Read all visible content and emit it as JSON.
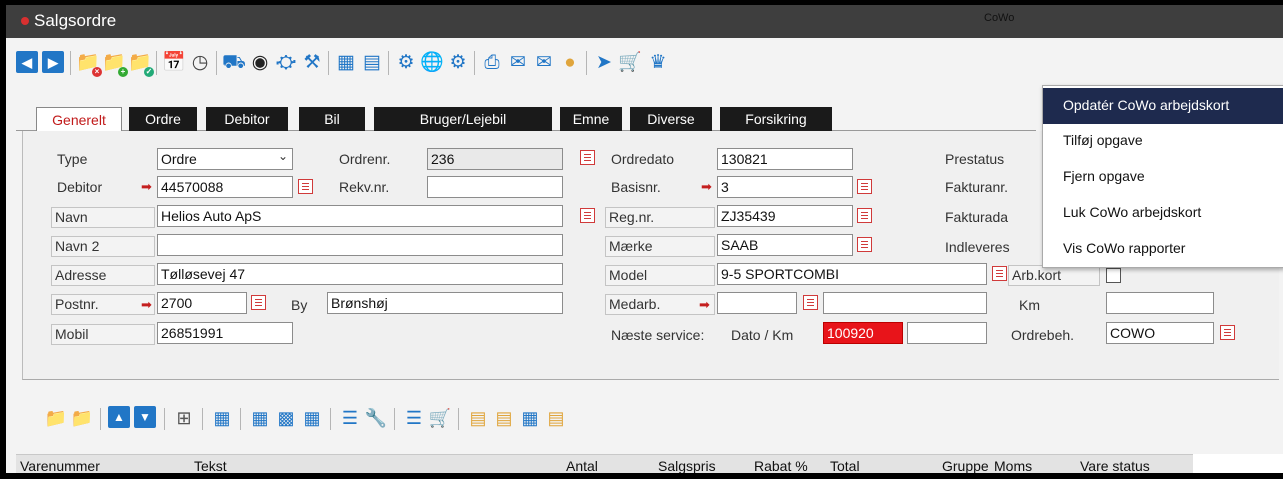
{
  "window": {
    "title": "Salgsordre"
  },
  "toolbar": {
    "icons": [
      "back-arrow",
      "forward-arrow",
      "folder-delete",
      "folder-add",
      "folder-check",
      "calendar",
      "clock",
      "truck",
      "tire",
      "car-key",
      "paint-bucket",
      "columns",
      "comment",
      "tools",
      "globe",
      "gear",
      "printer",
      "mail",
      "mail-checked",
      "coins",
      "document-send",
      "cart",
      "crown"
    ],
    "cowo_label": "CoWo"
  },
  "tabs": [
    "Generelt",
    "Ordre",
    "Debitor",
    "Bil",
    "Bruger/Lejebil",
    "Emne",
    "Diverse",
    "Forsikring"
  ],
  "form": {
    "type_label": "Type",
    "type_value": "Ordre",
    "ordrenr_label": "Ordrenr.",
    "ordrenr_value": "236",
    "ordredato_label": "Ordredato",
    "ordredato_value": "130821",
    "prestatus_label": "Prestatus",
    "debitor_label": "Debitor",
    "debitor_value": "44570088",
    "rekvnr_label": "Rekv.nr.",
    "rekvnr_value": "",
    "basisnr_label": "Basisnr.",
    "basisnr_value": "3",
    "fakturanr_label": "Fakturanr.",
    "navn_label": "Navn",
    "navn_value": "Helios Auto ApS",
    "regnr_label": "Reg.nr.",
    "regnr_value": "ZJ35439",
    "fakturadato_label": "Fakturada",
    "navn2_label": "Navn 2",
    "navn2_value": "",
    "maerke_label": "Mærke",
    "maerke_value": "SAAB",
    "indleveres_label": "Indleveres",
    "adresse_label": "Adresse",
    "adresse_value": "Tølløsevej 47",
    "model_label": "Model",
    "model_value": "9-5 SPORTCOMBI",
    "arbkort_label": "Arb.kort",
    "postnr_label": "Postnr.",
    "postnr_value": "2700",
    "by_label": "By",
    "by_value": "Brønshøj",
    "medarb_label": "Medarb.",
    "km_label": "Km",
    "mobil_label": "Mobil",
    "mobil_value": "26851991",
    "naeste_service_label": "Næste service:",
    "dato_km_label": "Dato / Km",
    "service_dato_value": "100920",
    "ordrebeh_label": "Ordrebeh.",
    "ordrebeh_value": "COWO"
  },
  "context_menu": {
    "items": [
      "Opdatér CoWo arbejdskort",
      "Tilføj opgave",
      "Fjern opgave",
      "Luk CoWo arbejdskort",
      "Vis CoWo rapporter"
    ],
    "highlighted_index": 0
  },
  "lines_toolbar": {
    "icons": [
      "folder-delete",
      "folder-add",
      "move-up",
      "move-down",
      "insert-row",
      "grid",
      "table",
      "table-link",
      "table-edit",
      "list-tools",
      "wrench",
      "list-cart",
      "cart",
      "doc-table",
      "doc-globe",
      "table-stack",
      "coins-doc"
    ]
  },
  "grid": {
    "columns": [
      "Varenummer",
      "Tekst",
      "Antal",
      "Salgspris",
      "Rabat %",
      "Total",
      "Gruppe",
      "Moms",
      "Vare status"
    ]
  },
  "colors": {
    "title_bar": "#3e3e3e",
    "accent_blue": "#2176c6",
    "service_red": "#e8141a",
    "menu_highlight": "#1e2a4e",
    "tab_dark": "#1a1a1a",
    "active_tab_text": "#c11a1a"
  }
}
